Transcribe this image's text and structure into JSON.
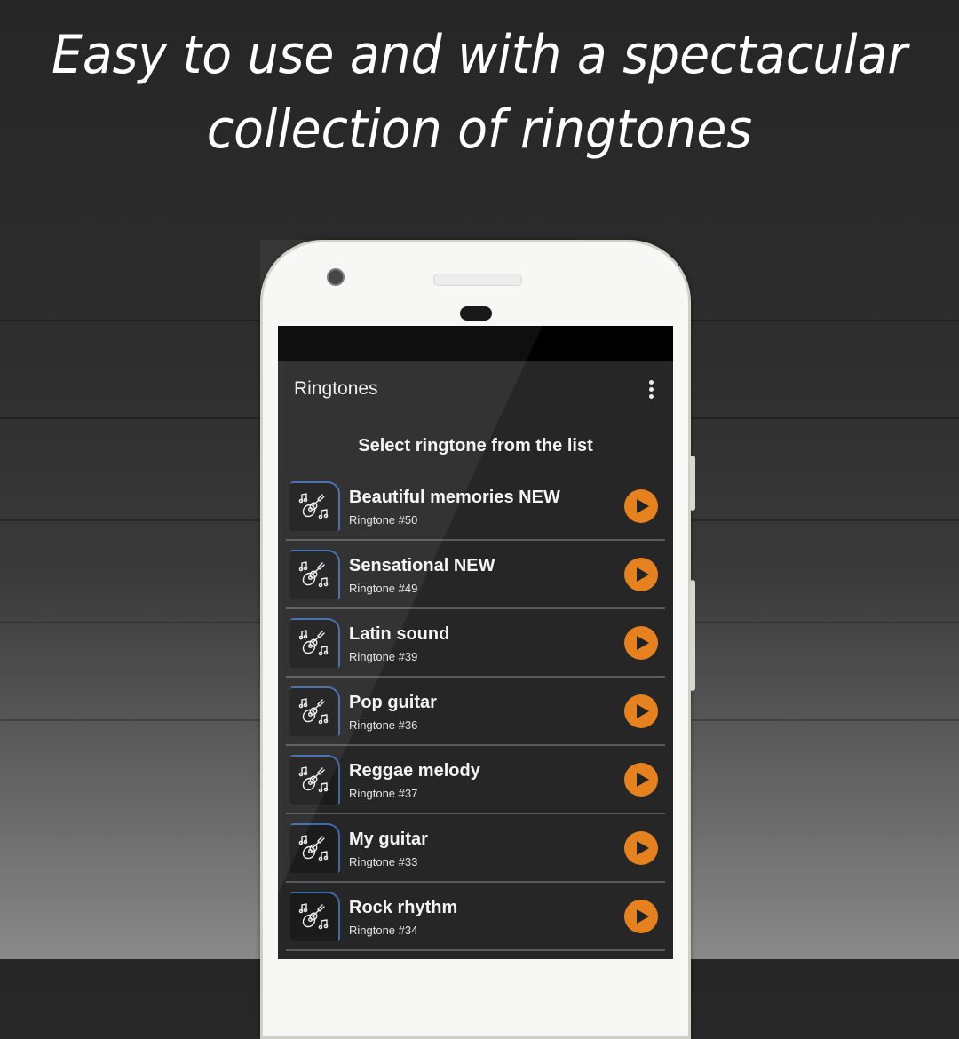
{
  "headline": {
    "line1": "Easy to use and with a spectacular",
    "line2": "collection of ringtones"
  },
  "app": {
    "title": "Ringtones",
    "menu_icon": "more-vert-icon",
    "subtitle": "Select ringtone from the list",
    "accent_color": "#e5821f",
    "thumb_border_color": "#3d6bb0"
  },
  "ringtones": [
    {
      "name": "Beautiful memories NEW",
      "number": "Ringtone #50",
      "icon": "guitar-notes-icon",
      "action_icon": "play-icon"
    },
    {
      "name": "Sensational NEW",
      "number": "Ringtone #49",
      "icon": "guitar-notes-icon",
      "action_icon": "play-icon"
    },
    {
      "name": "Latin sound",
      "number": "Ringtone #39",
      "icon": "guitar-notes-icon",
      "action_icon": "play-icon"
    },
    {
      "name": "Pop guitar",
      "number": "Ringtone #36",
      "icon": "guitar-notes-icon",
      "action_icon": "play-icon"
    },
    {
      "name": "Reggae melody",
      "number": "Ringtone #37",
      "icon": "guitar-notes-icon",
      "action_icon": "play-icon"
    },
    {
      "name": "My guitar",
      "number": "Ringtone #33",
      "icon": "guitar-notes-icon",
      "action_icon": "play-icon"
    },
    {
      "name": "Rock rhythm",
      "number": "Ringtone #34",
      "icon": "guitar-notes-icon",
      "action_icon": "play-icon"
    }
  ]
}
